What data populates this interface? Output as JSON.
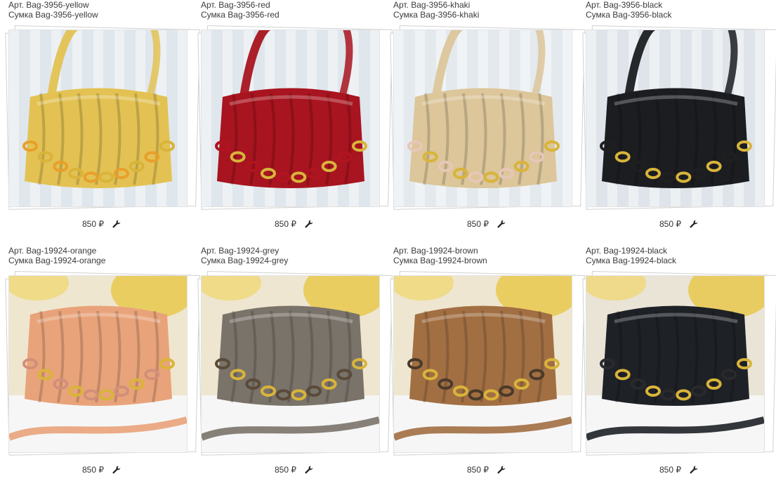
{
  "products": [
    {
      "article": "Арт. Bag-3956-yellow",
      "name": "Сумка Bag-3956-yellow",
      "price": "850 ₽",
      "color": "#e3c253",
      "bg": "#dfe6ec",
      "chain": "#e8a02a"
    },
    {
      "article": "Арт. Bag-3956-red",
      "name": "Сумка Bag-3956-red",
      "price": "850 ₽",
      "color": "#a8141f",
      "bg": "#dfe6ec",
      "chain": "#b0141f"
    },
    {
      "article": "Арт. Bag-3956-khaki",
      "name": "Сумка Bag-3956-khaki",
      "price": "850 ₽",
      "color": "#dcc69a",
      "bg": "#e4e9ee",
      "chain": "#e7c7b8"
    },
    {
      "article": "Арт. Bag-3956-black",
      "name": "Сумка Bag-3956-black",
      "price": "850 ₽",
      "color": "#1b1d21",
      "bg": "#dfe4ea",
      "chain": "#1f1f1f"
    },
    {
      "article": "Арт. Bag-19924-orange",
      "name": "Сумка Bag-19924-orange",
      "price": "850 ₽",
      "color": "#e9a37a",
      "bg": "#efe6cf",
      "chain": "#d28f7a"
    },
    {
      "article": "Арт. Bag-19924-grey",
      "name": "Сумка Bag-19924-grey",
      "price": "850 ₽",
      "color": "#7a736a",
      "bg": "#eee6d0",
      "chain": "#5a4a38"
    },
    {
      "article": "Арт. Bag-19924-brown",
      "name": "Сумка Bag-19924-brown",
      "price": "850 ₽",
      "color": "#a26f43",
      "bg": "#eee6d0",
      "chain": "#4a3a2a"
    },
    {
      "article": "Арт. Bag-19924-black",
      "name": "Сумка Bag-19924-black",
      "price": "850 ₽",
      "color": "#1e2126",
      "bg": "#e9e4d6",
      "chain": "#2a2a2e"
    }
  ],
  "icons": {
    "edit": "wrench-icon"
  }
}
